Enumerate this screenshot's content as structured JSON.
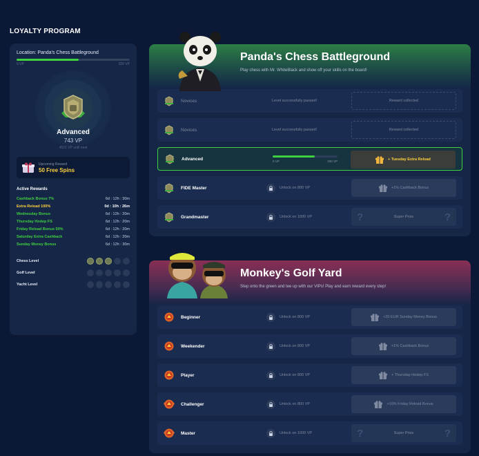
{
  "page": {
    "title": "LOYALTY PROGRAM"
  },
  "colors": {
    "accent_green": "#3fd13f",
    "accent_gold": "#ffd23f",
    "panel": "#152647",
    "background": "#0b1836"
  },
  "sidebar": {
    "location_label": "Location: Panda's Chess Battleground",
    "progress_fraction": 0.55,
    "progress_min": "0 VP",
    "progress_max": "200 VP",
    "medal_icon": "advanced-medal-icon",
    "level_name": "Advanced",
    "level_vp": "743 VP",
    "level_note": "4521 VP until next",
    "upcoming": {
      "title": "Upcoming Reward",
      "value": "50 Free Spins",
      "icon": "gift-icon"
    },
    "active_rewards_title": "Active Rewards",
    "active_rewards": [
      {
        "name": "Cashback Bonus 7%",
        "time": "6d : 12h : 30m"
      },
      {
        "name": "Extra Reload 100%",
        "time": "0d : 10h : 26m"
      },
      {
        "name": "Wednesday Bonus",
        "time": "6d : 12h : 20m"
      },
      {
        "name": "Thursday Hodep FS",
        "time": "6d : 12h : 20m"
      },
      {
        "name": "Friday Reload Bonus 50%",
        "time": "6d : 12h : 20m"
      },
      {
        "name": "Saturday Extra Cashback",
        "time": "6d : 12h : 20m"
      },
      {
        "name": "Sunday Money Bonus",
        "time": "6d : 12h : 30m"
      }
    ],
    "levels": [
      {
        "name": "Chess Level",
        "completed": 3,
        "total": 5
      },
      {
        "name": "Golf Level",
        "completed": 0,
        "total": 5
      },
      {
        "name": "Yacht Level",
        "completed": 0,
        "total": 5
      }
    ]
  },
  "panda_card": {
    "title": "Panda's Chess Battleground",
    "description": "Play chess with Mr. WhiteBlack and show off your skills on the board!",
    "mascot_icon": "panda-mascot-icon",
    "rows": [
      {
        "name": "Novices",
        "status": "Level successfully passed!",
        "reward": "Reward collected"
      },
      {
        "name": "Novices",
        "status": "Level successfully passed!",
        "reward": "Reward collected"
      },
      {
        "name": "Advanced",
        "progress_fraction": 0.65,
        "progress_min": "0 VP",
        "progress_max": "200 VP",
        "reward": "+ Tuesday Extra Reload"
      },
      {
        "name": "FIDE Master",
        "unlock": "Unlock on 800 VP",
        "reward": "+1% Cashback Bonus"
      },
      {
        "name": "Grandmaster",
        "unlock": "Unlock on 1000 VP",
        "reward": "Super Prize"
      }
    ]
  },
  "monkey_card": {
    "title": "Monkey's Golf Yard",
    "description": "Step onto the green and tee up with our VIPs! Play and earn reward every step!",
    "mascot_icon": "monkeys-mascot-icon",
    "rows": [
      {
        "name": "Beginner",
        "unlock": "Unlock on 800 VP",
        "reward": "+20 EUR Sunday Money Bonus"
      },
      {
        "name": "Weekender",
        "unlock": "Unlock on 800 VP",
        "reward": "+1% Cashback Bonus"
      },
      {
        "name": "Player",
        "unlock": "Unlock on 800 VP",
        "reward": "+ Thursday Hodep FS"
      },
      {
        "name": "Challenger",
        "unlock": "Unlock on 800 VP",
        "reward": "+10% Friday Reload Bonus"
      },
      {
        "name": "Master",
        "unlock": "Unlock on 1000 VP",
        "reward": "Super Prize"
      }
    ]
  }
}
